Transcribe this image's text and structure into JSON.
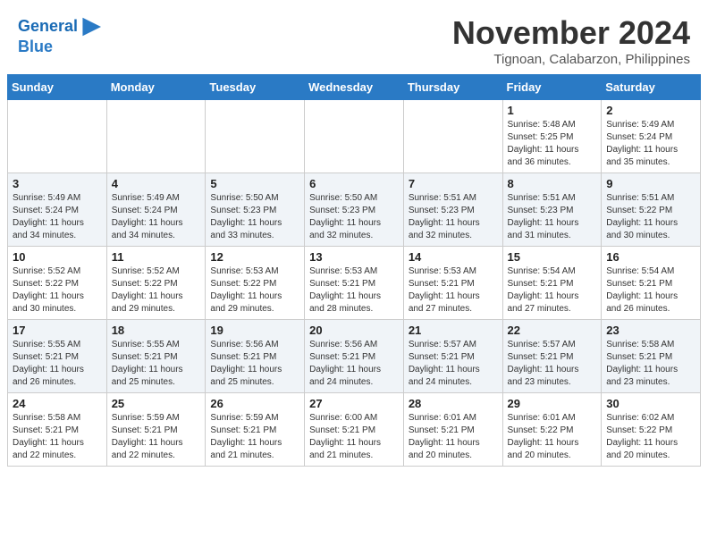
{
  "header": {
    "logo_line1": "General",
    "logo_line2": "Blue",
    "month": "November 2024",
    "location": "Tignoan, Calabarzon, Philippines"
  },
  "weekdays": [
    "Sunday",
    "Monday",
    "Tuesday",
    "Wednesday",
    "Thursday",
    "Friday",
    "Saturday"
  ],
  "weeks": [
    [
      {
        "day": "",
        "info": ""
      },
      {
        "day": "",
        "info": ""
      },
      {
        "day": "",
        "info": ""
      },
      {
        "day": "",
        "info": ""
      },
      {
        "day": "",
        "info": ""
      },
      {
        "day": "1",
        "info": "Sunrise: 5:48 AM\nSunset: 5:25 PM\nDaylight: 11 hours\nand 36 minutes."
      },
      {
        "day": "2",
        "info": "Sunrise: 5:49 AM\nSunset: 5:24 PM\nDaylight: 11 hours\nand 35 minutes."
      }
    ],
    [
      {
        "day": "3",
        "info": "Sunrise: 5:49 AM\nSunset: 5:24 PM\nDaylight: 11 hours\nand 34 minutes."
      },
      {
        "day": "4",
        "info": "Sunrise: 5:49 AM\nSunset: 5:24 PM\nDaylight: 11 hours\nand 34 minutes."
      },
      {
        "day": "5",
        "info": "Sunrise: 5:50 AM\nSunset: 5:23 PM\nDaylight: 11 hours\nand 33 minutes."
      },
      {
        "day": "6",
        "info": "Sunrise: 5:50 AM\nSunset: 5:23 PM\nDaylight: 11 hours\nand 32 minutes."
      },
      {
        "day": "7",
        "info": "Sunrise: 5:51 AM\nSunset: 5:23 PM\nDaylight: 11 hours\nand 32 minutes."
      },
      {
        "day": "8",
        "info": "Sunrise: 5:51 AM\nSunset: 5:23 PM\nDaylight: 11 hours\nand 31 minutes."
      },
      {
        "day": "9",
        "info": "Sunrise: 5:51 AM\nSunset: 5:22 PM\nDaylight: 11 hours\nand 30 minutes."
      }
    ],
    [
      {
        "day": "10",
        "info": "Sunrise: 5:52 AM\nSunset: 5:22 PM\nDaylight: 11 hours\nand 30 minutes."
      },
      {
        "day": "11",
        "info": "Sunrise: 5:52 AM\nSunset: 5:22 PM\nDaylight: 11 hours\nand 29 minutes."
      },
      {
        "day": "12",
        "info": "Sunrise: 5:53 AM\nSunset: 5:22 PM\nDaylight: 11 hours\nand 29 minutes."
      },
      {
        "day": "13",
        "info": "Sunrise: 5:53 AM\nSunset: 5:21 PM\nDaylight: 11 hours\nand 28 minutes."
      },
      {
        "day": "14",
        "info": "Sunrise: 5:53 AM\nSunset: 5:21 PM\nDaylight: 11 hours\nand 27 minutes."
      },
      {
        "day": "15",
        "info": "Sunrise: 5:54 AM\nSunset: 5:21 PM\nDaylight: 11 hours\nand 27 minutes."
      },
      {
        "day": "16",
        "info": "Sunrise: 5:54 AM\nSunset: 5:21 PM\nDaylight: 11 hours\nand 26 minutes."
      }
    ],
    [
      {
        "day": "17",
        "info": "Sunrise: 5:55 AM\nSunset: 5:21 PM\nDaylight: 11 hours\nand 26 minutes."
      },
      {
        "day": "18",
        "info": "Sunrise: 5:55 AM\nSunset: 5:21 PM\nDaylight: 11 hours\nand 25 minutes."
      },
      {
        "day": "19",
        "info": "Sunrise: 5:56 AM\nSunset: 5:21 PM\nDaylight: 11 hours\nand 25 minutes."
      },
      {
        "day": "20",
        "info": "Sunrise: 5:56 AM\nSunset: 5:21 PM\nDaylight: 11 hours\nand 24 minutes."
      },
      {
        "day": "21",
        "info": "Sunrise: 5:57 AM\nSunset: 5:21 PM\nDaylight: 11 hours\nand 24 minutes."
      },
      {
        "day": "22",
        "info": "Sunrise: 5:57 AM\nSunset: 5:21 PM\nDaylight: 11 hours\nand 23 minutes."
      },
      {
        "day": "23",
        "info": "Sunrise: 5:58 AM\nSunset: 5:21 PM\nDaylight: 11 hours\nand 23 minutes."
      }
    ],
    [
      {
        "day": "24",
        "info": "Sunrise: 5:58 AM\nSunset: 5:21 PM\nDaylight: 11 hours\nand 22 minutes."
      },
      {
        "day": "25",
        "info": "Sunrise: 5:59 AM\nSunset: 5:21 PM\nDaylight: 11 hours\nand 22 minutes."
      },
      {
        "day": "26",
        "info": "Sunrise: 5:59 AM\nSunset: 5:21 PM\nDaylight: 11 hours\nand 21 minutes."
      },
      {
        "day": "27",
        "info": "Sunrise: 6:00 AM\nSunset: 5:21 PM\nDaylight: 11 hours\nand 21 minutes."
      },
      {
        "day": "28",
        "info": "Sunrise: 6:01 AM\nSunset: 5:21 PM\nDaylight: 11 hours\nand 20 minutes."
      },
      {
        "day": "29",
        "info": "Sunrise: 6:01 AM\nSunset: 5:22 PM\nDaylight: 11 hours\nand 20 minutes."
      },
      {
        "day": "30",
        "info": "Sunrise: 6:02 AM\nSunset: 5:22 PM\nDaylight: 11 hours\nand 20 minutes."
      }
    ]
  ]
}
